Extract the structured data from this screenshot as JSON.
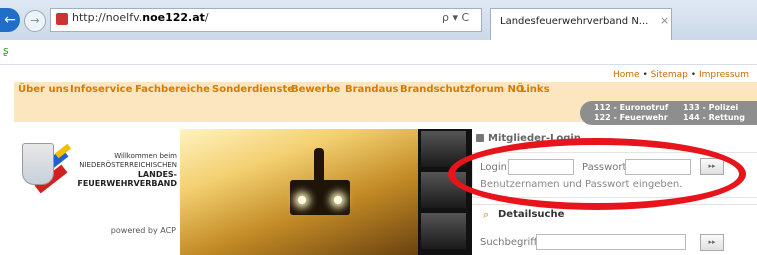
{
  "browser": {
    "url_prefix": "http://noelfv.",
    "url_domain": "noe122.at",
    "url_suffix": "/",
    "search_icons": "ρ ▾ C",
    "tab_title": "Landesfeuerwehrverband N...",
    "tab_close": "×",
    "back_glyph": "←",
    "forward_glyph": "→",
    "favorites_glyph": "ʂ"
  },
  "toplinks": {
    "home": "Home",
    "sitemap": "Sitemap",
    "impressum": "Impressum",
    "sep": "•"
  },
  "nav": [
    "Über uns",
    "Infoservice",
    "Fachbereiche",
    "Sonderdienste",
    "Bewerbe",
    "Brandaus",
    "Brandschutzforum NÖ",
    "Links"
  ],
  "emergency": {
    "line1_left": "112 - Euronotruf",
    "line2_left": "122 - Feuerwehr",
    "line1_right": "133 - Polizei",
    "line2_right": "144 - Rettung"
  },
  "logo": {
    "welcome": "Willkommen beim",
    "line1": "NIEDERÖSTERREICHISCHEN",
    "line2": "LANDES-",
    "line3": "FEUERWEHRVERBAND",
    "powered": "powered by ACP"
  },
  "login": {
    "title": "Mitglieder-Login",
    "login_label": "Login:",
    "password_label": "Passwort:",
    "button": "▸▸",
    "hint": "Benutzernamen und Passwort eingeben."
  },
  "search": {
    "icon": "⌕",
    "title": "Detailsuche",
    "label": "Suchbegriff:",
    "button": "▸▸"
  },
  "colors": {
    "nav_text": "#d77b00",
    "nav_bg": "#fbe6bf",
    "annotation": "#e8141b"
  }
}
